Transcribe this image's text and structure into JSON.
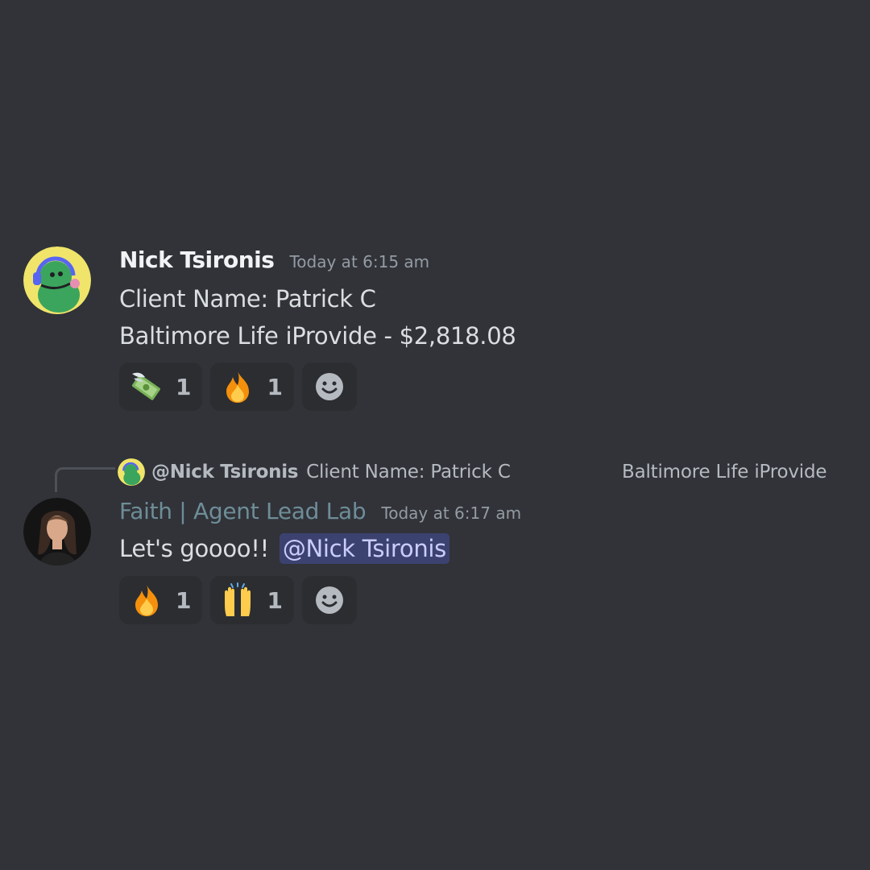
{
  "messages": [
    {
      "author": "Nick Tsironis",
      "timestamp": "Today at 6:15 am",
      "lines": [
        "Client Name: Patrick C",
        "Baltimore Life iProvide - $2,818.08"
      ],
      "reactions": [
        {
          "emoji": "money-with-wings",
          "count": "1"
        },
        {
          "emoji": "fire",
          "count": "1"
        }
      ],
      "add_reaction_icon": "smiley-face-icon"
    },
    {
      "reply_to": {
        "mention": "@Nick Tsironis",
        "preview": "Client Name: Patrick C",
        "preview_continued": "Baltimore Life iProvide"
      },
      "author": "Faith | Agent Lead Lab",
      "author_color": "#6e8d98",
      "timestamp": "Today at 6:17 am",
      "text": "Let's goooo!!",
      "mention": "@Nick Tsironis",
      "reactions": [
        {
          "emoji": "fire",
          "count": "1"
        },
        {
          "emoji": "raising-hands",
          "count": "1"
        }
      ],
      "add_reaction_icon": "smiley-face-icon"
    }
  ],
  "colors": {
    "background": "#313338",
    "mention_bg": "#3c4270",
    "mention_text": "#c9cdfb"
  }
}
